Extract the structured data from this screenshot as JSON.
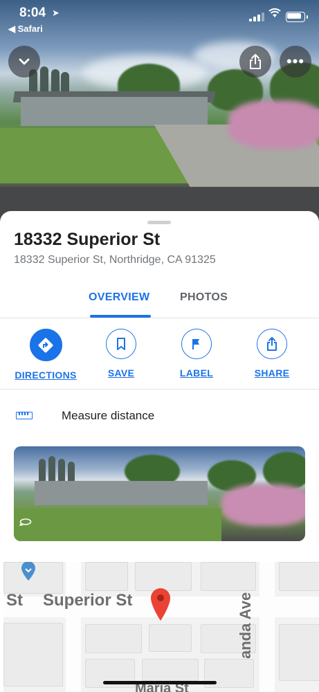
{
  "status_bar": {
    "time": "8:04",
    "back_app": "◀ Safari"
  },
  "header": {
    "collapse_icon": "chevron-down-icon",
    "share_icon": "share-icon",
    "more_icon": "more-horizontal-icon"
  },
  "place": {
    "title": "18332 Superior St",
    "address": "18332 Superior St, Northridge, CA 91325"
  },
  "tabs": [
    {
      "label": "OVERVIEW",
      "active": true
    },
    {
      "label": "PHOTOS",
      "active": false
    }
  ],
  "actions": [
    {
      "label": "DIRECTIONS",
      "icon": "directions-icon"
    },
    {
      "label": "SAVE",
      "icon": "bookmark-icon"
    },
    {
      "label": "LABEL",
      "icon": "flag-icon"
    },
    {
      "label": "SHARE",
      "icon": "share-icon"
    }
  ],
  "measure": {
    "label": "Measure distance",
    "icon": "ruler-icon"
  },
  "map": {
    "labels": {
      "left_fragment": "St",
      "street": "Superior St",
      "avenue": "anda Ave",
      "bottom_fragment": "Maria St"
    },
    "pin_color": "#ea4335"
  },
  "colors": {
    "accent": "#1a73e8"
  }
}
